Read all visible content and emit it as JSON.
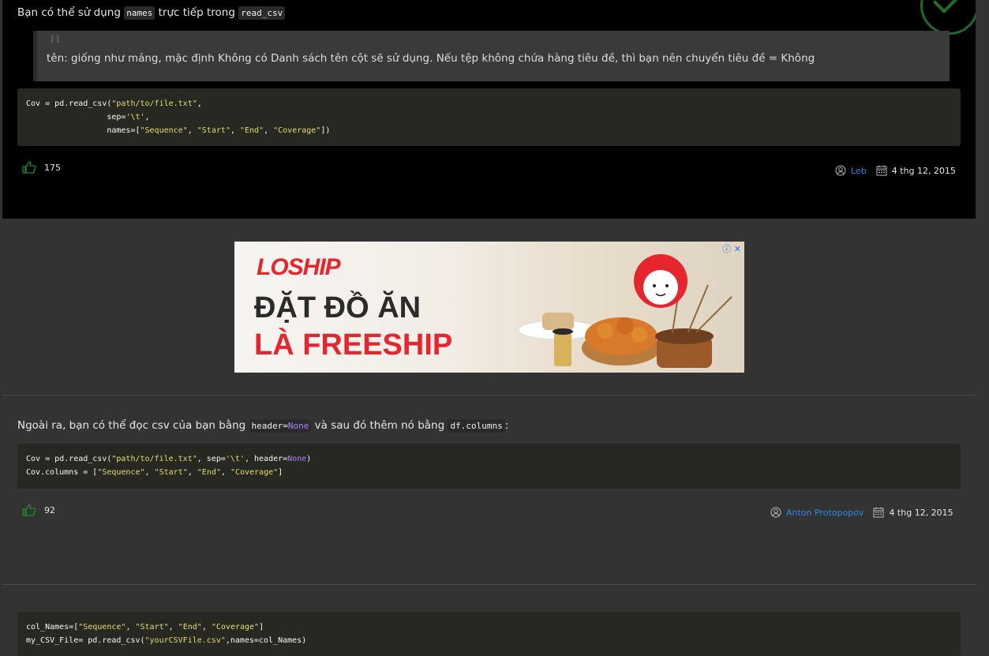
{
  "answer1": {
    "text_before": "Bạn có thể sử dụng ",
    "code_names": "names",
    "text_middle": " trực tiếp trong ",
    "code_read_csv": "read_csv",
    "quote": "tên: giống như mảng, mặc định Không có Danh sách tên cột sẽ sử dụng. Nếu tệp không chứa hàng tiêu đề, thì bạn nên chuyển tiêu đề = Không",
    "code_lines": [
      [
        "Cov = pd.read_csv(",
        "\"path/to/file.txt\"",
        ","
      ],
      [
        "                 sep=",
        "'\\t'",
        ","
      ],
      [
        "                 names=[",
        "\"Sequence\"",
        ", ",
        "\"Start\"",
        ", ",
        "\"End\"",
        ", ",
        "\"Coverage\"",
        "])"
      ]
    ],
    "votes": "175",
    "author": "Leb",
    "date": "4 thg 12, 2015"
  },
  "ad": {
    "brand": "LOSHIP",
    "line1": "ĐẶT ĐỒ ĂN",
    "line2": "LÀ FREESHIP",
    "controls": "ⓘ ✕"
  },
  "answer2": {
    "text_before": "Ngoài ra, bạn có thể đọc csv của bạn bằng ",
    "code_header": "header=",
    "code_none": "None",
    "text_middle": " và sau đó thêm nó bằng ",
    "code_df_columns": "df.columns",
    "text_after": ":",
    "votes": "92",
    "author": "Anton Protopopov",
    "date": "4 thg 12, 2015"
  },
  "colors": {
    "background": "#333333",
    "answer_bg": "#000000",
    "code_bg": "#272822",
    "string": "#e6db74",
    "keyword": "#ae81ff",
    "link": "#2d86e8",
    "vote_icon": "#1f8a2c"
  }
}
